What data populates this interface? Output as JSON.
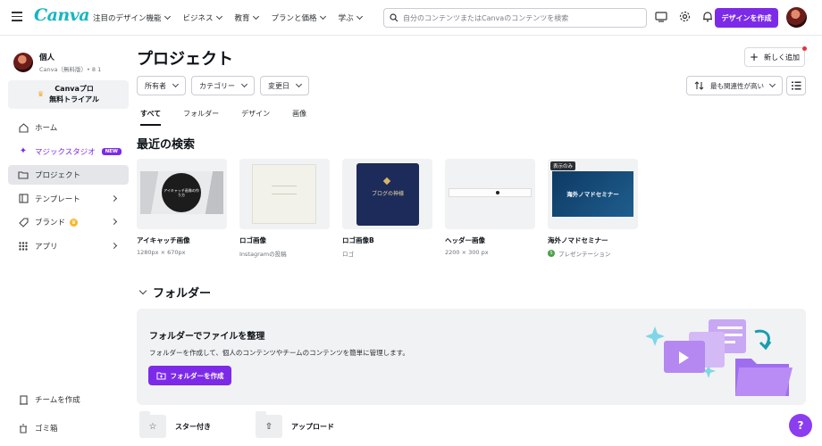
{
  "app": {
    "logo": "Canva",
    "brand_color": "#7d2ae8",
    "logo_color": "#16b5c4"
  },
  "nav": {
    "items": [
      {
        "label": "注目のデザイン機能"
      },
      {
        "label": "ビジネス"
      },
      {
        "label": "教育"
      },
      {
        "label": "プランと価格"
      },
      {
        "label": "学ぶ"
      }
    ]
  },
  "search": {
    "placeholder": "自分のコンテンツまたはCanvaのコンテンツを検索"
  },
  "header": {
    "create_label": "デザインを作成"
  },
  "profile": {
    "name": "個人",
    "sub": "Canva（無料版）• 8 1"
  },
  "trial": {
    "line1": "Canvaプロ",
    "line2": "無料トライアル"
  },
  "sidebar": {
    "items": [
      {
        "label": "ホーム",
        "icon": "home-icon"
      },
      {
        "label": "マジックスタジオ",
        "icon": "sparkle-icon",
        "badge": "NEW"
      },
      {
        "label": "プロジェクト",
        "icon": "folder-icon"
      },
      {
        "label": "テンプレート",
        "icon": "template-icon"
      },
      {
        "label": "ブランド",
        "icon": "brand-icon"
      },
      {
        "label": "アプリ",
        "icon": "apps-icon"
      }
    ],
    "bottom": [
      {
        "label": "チームを作成",
        "icon": "building-icon"
      },
      {
        "label": "ゴミ箱",
        "icon": "trash-icon"
      }
    ]
  },
  "main": {
    "title": "プロジェクト",
    "add_new": "新しく追加",
    "filters": [
      "所有者",
      "カテゴリー",
      "変更日"
    ],
    "sort": "最も関連性が高い",
    "tabs": [
      "すべて",
      "フォルダー",
      "デザイン",
      "画像"
    ],
    "recent_title": "最近の検索",
    "cards": [
      {
        "title": "アイキャッチ画像",
        "sub": "1280px × 670px",
        "thumb_text": "アイキャッチ画像の作り方"
      },
      {
        "title": "ロゴ画像",
        "sub": "Instagramの投稿",
        "thumb_text": ""
      },
      {
        "title": "ロゴ画像B",
        "sub": "ロゴ",
        "thumb_text": "ブログの神様"
      },
      {
        "title": "ヘッダー画像",
        "sub": "2200 × 300 px",
        "thumb_text": ""
      },
      {
        "title": "海外ノマドセミナー",
        "sub": "プレゼンテーション",
        "thumb_text": "海外ノマドセミナー",
        "badge": "表示のみ"
      }
    ],
    "folders_title": "フォルダー",
    "folder_box": {
      "title": "フォルダーでファイルを整理",
      "desc": "フォルダーを作成して、個人のコンテンツやチームのコンテンツを簡単に管理します。",
      "button": "フォルダーを作成"
    },
    "bottom_folders": [
      {
        "label": "スター付き",
        "icon": "star-icon"
      },
      {
        "label": "アップロード",
        "icon": "upload-icon"
      }
    ],
    "help": "?"
  }
}
